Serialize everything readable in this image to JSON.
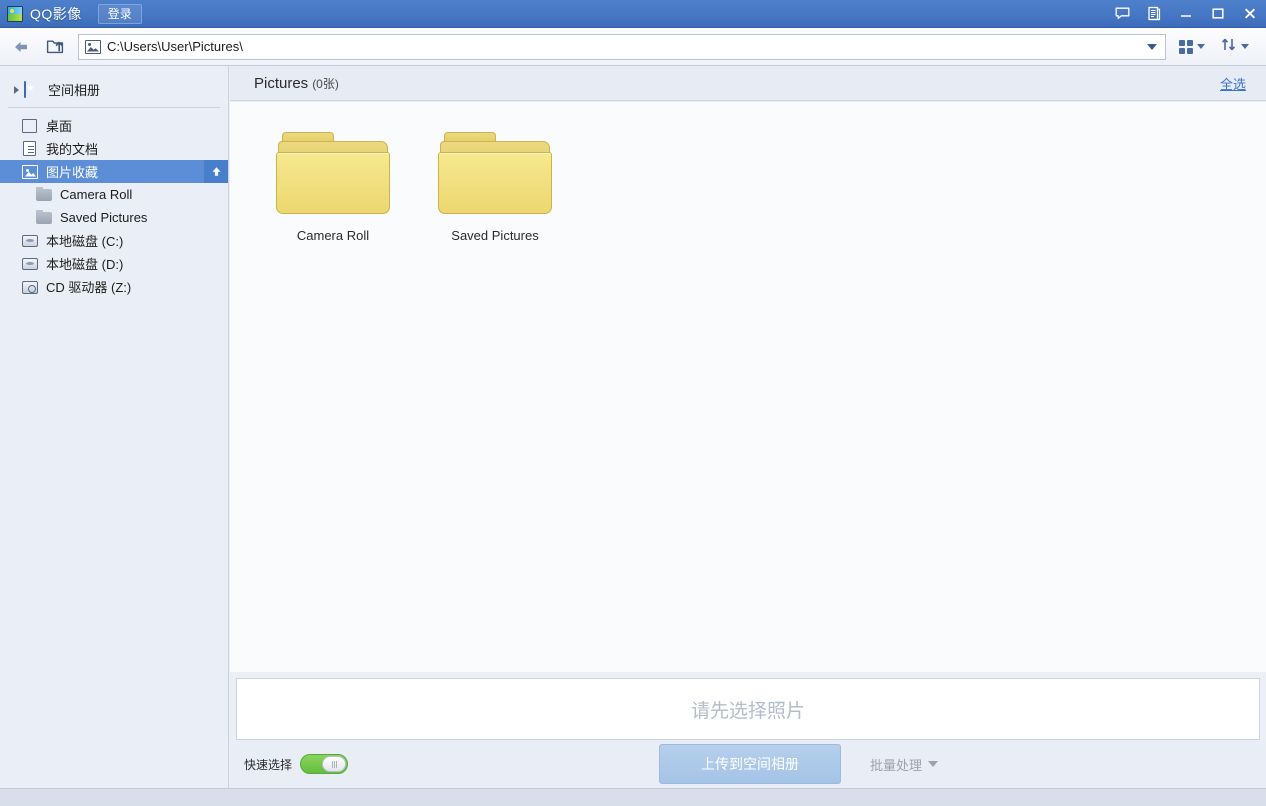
{
  "window": {
    "app_title": "QQ影像",
    "logo_icon": "qq-image-logo-icon",
    "login_label": "登录",
    "controls": [
      {
        "name": "feedback-icon",
        "label": "feedback"
      },
      {
        "name": "notes-icon",
        "label": "notes"
      },
      {
        "name": "minimize-icon",
        "label": "minimize"
      },
      {
        "name": "maximize-icon",
        "label": "maximize"
      },
      {
        "name": "close-icon",
        "label": "close"
      }
    ]
  },
  "toolbar": {
    "back_icon": "back-arrow-icon",
    "up_icon": "folder-up-icon",
    "address": {
      "icon": "picture-icon",
      "value": "C:\\Users\\User\\Pictures\\",
      "placeholder": "C:\\Users\\User\\Pictures\\",
      "dropdown_icon": "chevron-down-icon"
    },
    "view_button": {
      "icon": "grid-view-icon",
      "dropdown_icon": "chevron-down-icon"
    },
    "sort_button": {
      "icon": "sort-icon",
      "dropdown_icon": "chevron-down-icon"
    }
  },
  "sidebar": {
    "cloud": {
      "label": "空间相册",
      "icon": "album-icon",
      "expander_icon": "chevron-right-icon"
    },
    "items": [
      {
        "label": "桌面",
        "icon": "desktop-icon",
        "kind": "desktop",
        "indent": 0,
        "selected": false
      },
      {
        "label": "我的文档",
        "icon": "documents-icon",
        "kind": "doc",
        "indent": 0,
        "selected": false
      },
      {
        "label": "图片收藏",
        "icon": "pictures-icon",
        "kind": "pic",
        "indent": 0,
        "selected": true,
        "badge_icon": "up-arrow-icon"
      },
      {
        "label": "Camera Roll",
        "icon": "folder-icon",
        "kind": "folder",
        "indent": 1,
        "selected": false
      },
      {
        "label": "Saved Pictures",
        "icon": "folder-icon",
        "kind": "folder",
        "indent": 1,
        "selected": false
      },
      {
        "label": "本地磁盘 (C:)",
        "icon": "drive-icon",
        "kind": "drive",
        "indent": 0,
        "selected": false
      },
      {
        "label": "本地磁盘 (D:)",
        "icon": "drive-icon",
        "kind": "drive",
        "indent": 0,
        "selected": false
      },
      {
        "label": "CD 驱动器 (Z:)",
        "icon": "cd-drive-icon",
        "kind": "cd",
        "indent": 0,
        "selected": false
      }
    ]
  },
  "content": {
    "title": "Pictures",
    "count_text": "(0张)",
    "select_all_label": "全选",
    "folders": [
      {
        "name": "Camera Roll",
        "icon": "folder-icon"
      },
      {
        "name": "Saved Pictures",
        "icon": "folder-icon"
      }
    ]
  },
  "bottom": {
    "tray_placeholder": "请先选择照片",
    "quick_select_label": "快速选择",
    "quick_select_on": true,
    "upload_label": "上传到空间相册",
    "batch_label": "批量处理",
    "batch_dropdown_icon": "chevron-down-icon"
  },
  "colors": {
    "titlebar_top": "#4d80cb",
    "titlebar_bottom": "#3c6cba",
    "selection_blue": "#5b8ed6",
    "link_blue": "#3a72c8",
    "toggle_green": "#62bf3e",
    "folder_yellow": "#f2e184",
    "upload_button": "#a4c3e6"
  }
}
